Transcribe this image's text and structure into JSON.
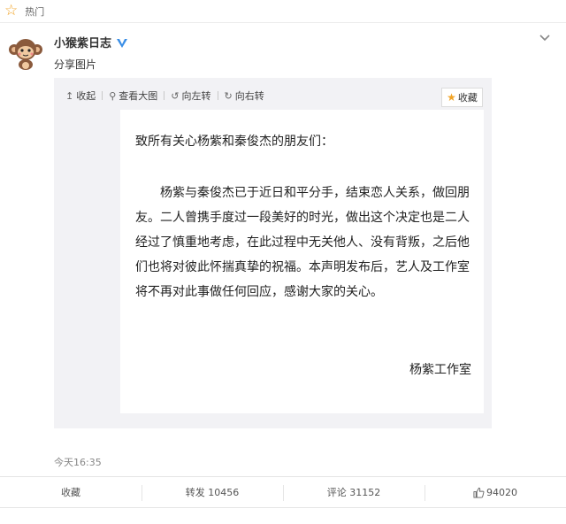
{
  "hot": {
    "label": "热门"
  },
  "post": {
    "author": "小猴紫日志",
    "subtitle": "分享图片",
    "timestamp": "今天16:35"
  },
  "image_toolbar": {
    "collapse": "收起",
    "view_large": "查看大图",
    "rotate_left": "向左转",
    "rotate_right": "向右转",
    "favorite": "收藏"
  },
  "document": {
    "greeting": "致所有关心杨紫和秦俊杰的朋友们：",
    "body": "杨紫与秦俊杰已于近日和平分手，结束恋人关系，做回朋友。二人曾携手度过一段美好的时光，做出这个决定也是二人经过了慎重地考虑，在此过程中无关他人、没有背叛，之后他们也将对彼此怀揣真挚的祝福。本声明发布后，艺人及工作室将不再对此事做任何回应，感谢大家的关心。",
    "signature": "杨紫工作室"
  },
  "actions": {
    "favorite": "收藏",
    "repost": "转发 10456",
    "comment": "评论 31152",
    "like": "94020"
  },
  "colors": {
    "accent_star": "#f1a325",
    "verified_blue": "#3a8ee6"
  }
}
